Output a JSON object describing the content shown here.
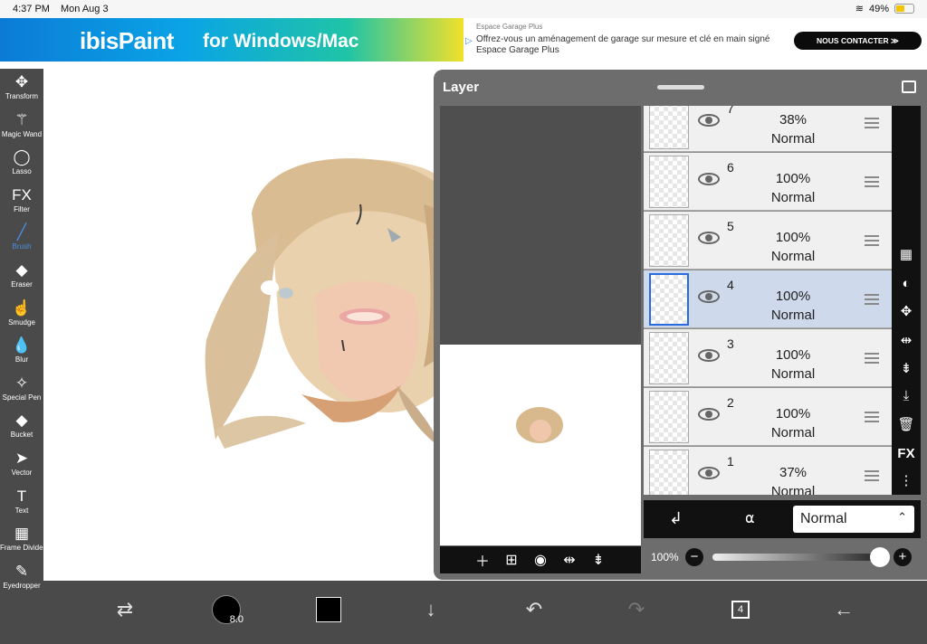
{
  "status": {
    "time": "4:37 PM",
    "date": "Mon Aug 3",
    "battery": "49%",
    "battery_level": 0.49
  },
  "ad": {
    "logo": "ibisPaint",
    "tagline": "for Windows/Mac",
    "source": "Espace Garage Plus",
    "text": "Offrez-vous un aménagement de garage sur mesure et clé en main signé Espace Garage Plus",
    "cta": "NOUS CONTACTER ≫"
  },
  "tools": [
    {
      "label": "Transform",
      "icon": "move-icon",
      "glyph": "✥"
    },
    {
      "label": "Magic Wand",
      "icon": "magic-wand-icon",
      "glyph": "⚚"
    },
    {
      "label": "Lasso",
      "icon": "lasso-icon",
      "glyph": "◯"
    },
    {
      "label": "Filter",
      "icon": "fx-icon",
      "glyph": "FX"
    },
    {
      "label": "Brush",
      "icon": "brush-icon",
      "glyph": "╱",
      "active": true
    },
    {
      "label": "Eraser",
      "icon": "eraser-icon",
      "glyph": "◆"
    },
    {
      "label": "Smudge",
      "icon": "smudge-icon",
      "glyph": "☝"
    },
    {
      "label": "Blur",
      "icon": "blur-icon",
      "glyph": "💧"
    },
    {
      "label": "Special Pen",
      "icon": "special-pen-icon",
      "glyph": "✧"
    },
    {
      "label": "Bucket",
      "icon": "bucket-icon",
      "glyph": "◆"
    },
    {
      "label": "Vector",
      "icon": "vector-icon",
      "glyph": "➤"
    },
    {
      "label": "Text",
      "icon": "text-icon",
      "glyph": "T"
    },
    {
      "label": "Frame Divider",
      "icon": "frame-divider-icon",
      "glyph": "▦"
    },
    {
      "label": "Eyedropper",
      "icon": "eyedropper-icon",
      "glyph": "✎"
    }
  ],
  "panel": {
    "title": "Layer"
  },
  "layers": [
    {
      "num": "7",
      "opacity": "38%",
      "blend": "Normal"
    },
    {
      "num": "6",
      "opacity": "100%",
      "blend": "Normal"
    },
    {
      "num": "5",
      "opacity": "100%",
      "blend": "Normal"
    },
    {
      "num": "4",
      "opacity": "100%",
      "blend": "Normal",
      "selected": true
    },
    {
      "num": "3",
      "opacity": "100%",
      "blend": "Normal"
    },
    {
      "num": "2",
      "opacity": "100%",
      "blend": "Normal"
    },
    {
      "num": "1",
      "opacity": "37%",
      "blend": "Normal"
    }
  ],
  "blend_mode": "Normal",
  "opacity_label": "100%",
  "opacity_value": 1.0,
  "brush_size": "8.0",
  "layer_count": "4",
  "colors": {
    "primary": "#000000",
    "accent": "#4a90e2",
    "selected_layer": "#cfd9ec"
  }
}
